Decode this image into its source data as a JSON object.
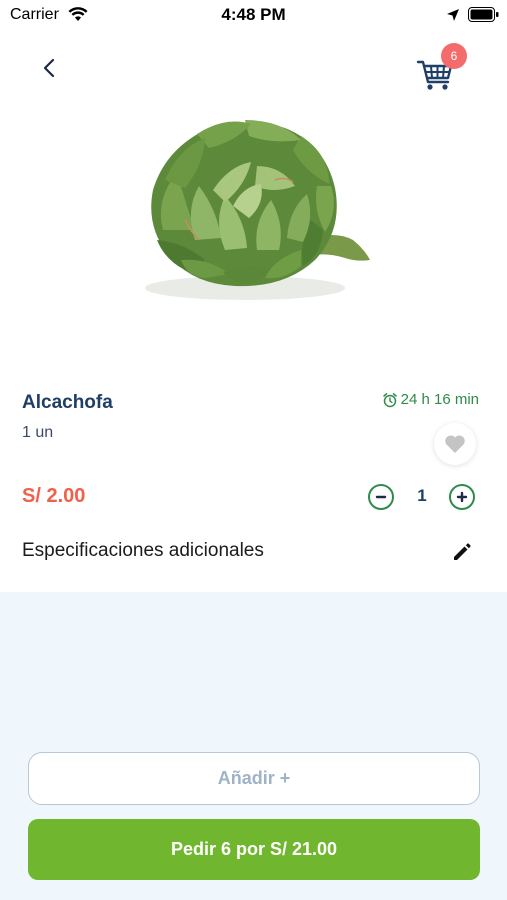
{
  "status_bar": {
    "carrier": "Carrier",
    "time": "4:48 PM"
  },
  "header": {
    "cart_count": "6"
  },
  "product": {
    "name": "Alcachofa",
    "unit": "1 un",
    "timer": "24 h 16 min",
    "price": "S/ 2.00",
    "quantity": "1",
    "image_icon": "artichoke-image"
  },
  "specs": {
    "label": "Especificaciones adicionales"
  },
  "actions": {
    "add_label": "Añadir +",
    "order_label": "Pedir 6 por S/ 21.00"
  },
  "colors": {
    "accent_green": "#71b62f",
    "price_red": "#f0604a",
    "badge_red": "#f36b6b",
    "timer_green": "#2e8b4a",
    "title_blue": "#1f3f68",
    "background": "#f0f7fc"
  }
}
